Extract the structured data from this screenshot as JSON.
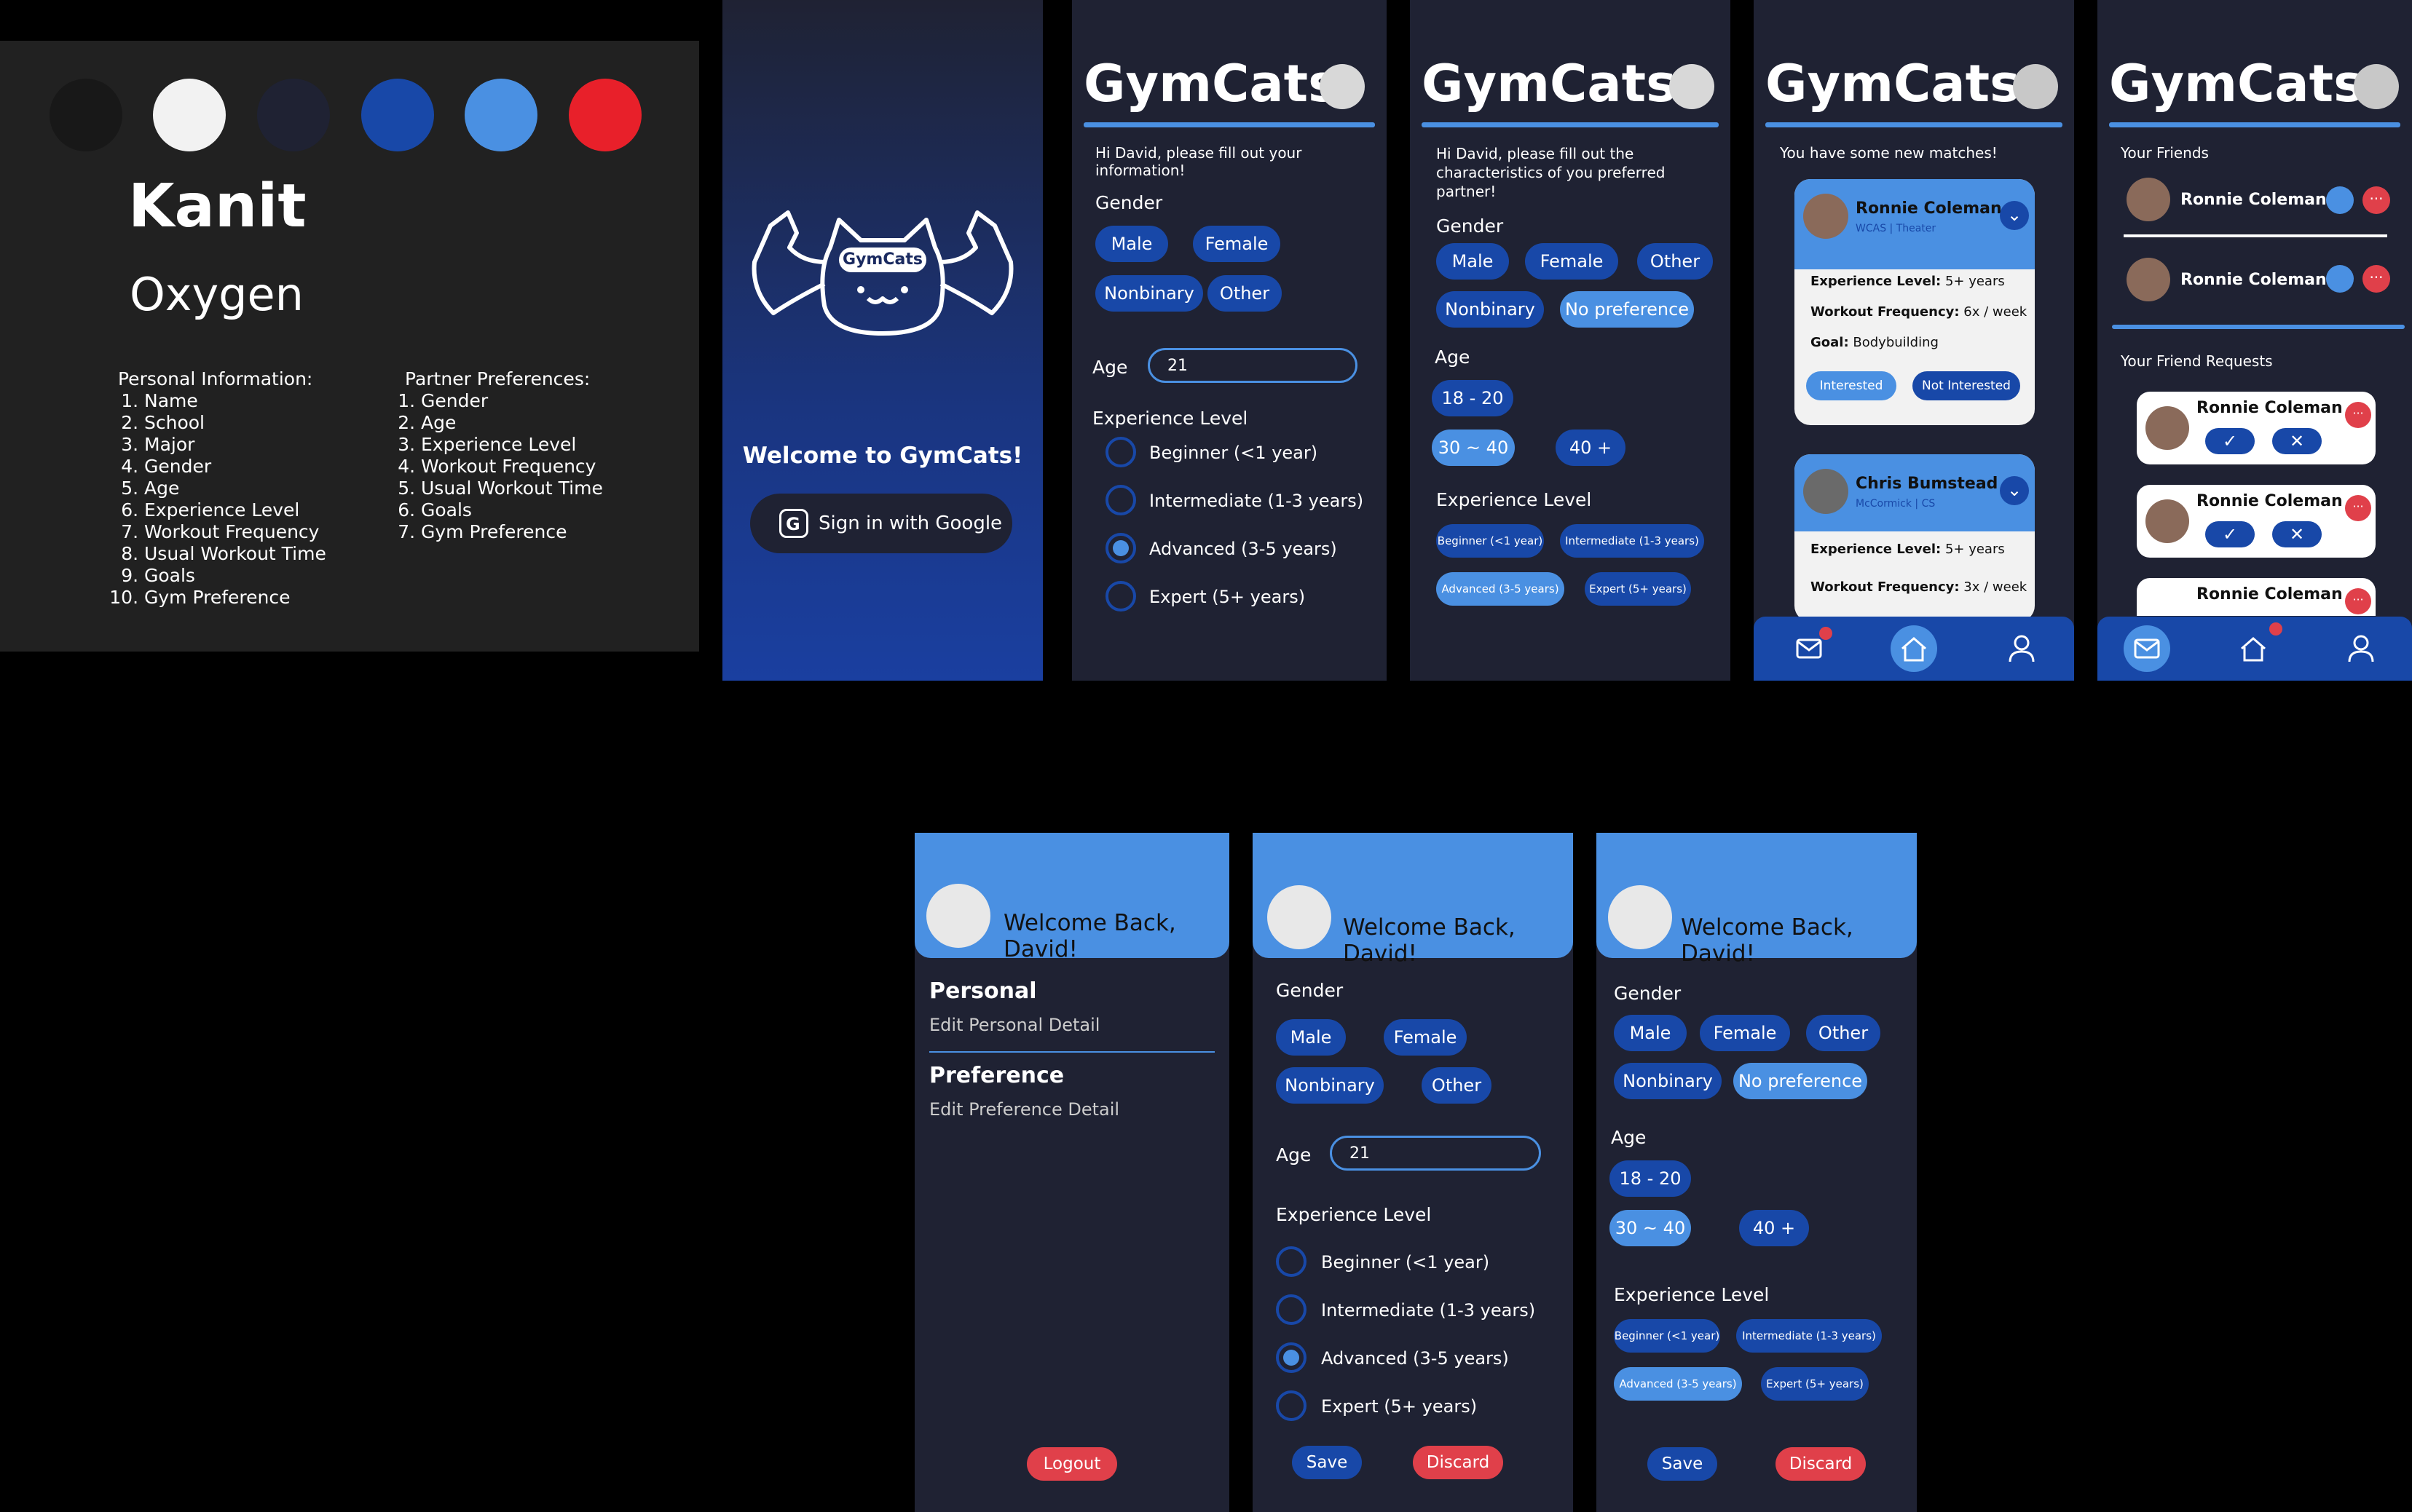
{
  "style_guide": {
    "colors": [
      "#181818",
      "#f2f2f2",
      "#1f2233",
      "#1848a8",
      "#4a90e2",
      "#e8202a"
    ],
    "font_primary": "Kanit",
    "font_secondary": "Oxygen",
    "personal_title": "Personal Information:",
    "personal_items": [
      "Name",
      "School",
      "Major",
      "Gender",
      "Age",
      "Experience Level",
      "Workout Frequency",
      "Usual Workout Time",
      "Goals",
      "Gym Preference"
    ],
    "partner_title": "Partner Preferences:",
    "partner_items": [
      "Gender",
      "Age",
      "Experience Level",
      "Workout Frequency",
      "Usual Workout Time",
      "Goals",
      "Gym Preference"
    ]
  },
  "welcome": {
    "logo_text": "GymCats",
    "title": "Welcome to GymCats!",
    "google_button": "Sign in with Google"
  },
  "app_title": "GymCats",
  "info_screen": {
    "prompt": "Hi David, please fill out your information!",
    "gender_label": "Gender",
    "genders": [
      "Male",
      "Female",
      "Nonbinary",
      "Other"
    ],
    "age_label": "Age",
    "age_value": "21",
    "exp_label": "Experience Level",
    "levels": [
      "Beginner (<1 year)",
      "Intermediate (1-3 years)",
      "Advanced (3-5 years)",
      "Expert (5+ years)"
    ]
  },
  "pref_screen": {
    "prompt": "Hi David, please fill out the characteristics of you preferred partner!",
    "gender_label": "Gender",
    "genders": [
      "Male",
      "Female",
      "Other",
      "Nonbinary",
      "No preference"
    ],
    "age_label": "Age",
    "ages": [
      "18 - 20",
      "30 ~ 40",
      "40 +"
    ],
    "exp_label": "Experience Level",
    "levels": [
      "Beginner (<1 year)",
      "Intermediate (1-3 years)",
      "Advanced (3-5 years)",
      "Expert (5+ years)"
    ]
  },
  "matches_screen": {
    "notice": "You have some new matches!",
    "card1": {
      "name": "Ronnie Coleman",
      "sub": "WCAS | Theater",
      "exp_k": "Experience Level:",
      "exp_v": "5+ years",
      "freq_k": "Workout Frequency:",
      "freq_v": "6x / week",
      "goal_k": "Goal:",
      "goal_v": "Bodybuilding",
      "interested": "Interested",
      "not_interested": "Not Interested"
    },
    "card2": {
      "name": "Chris Bumstead",
      "sub": "McCormick | CS",
      "exp_k": "Experience Level:",
      "exp_v": "5+ years",
      "freq_k": "Workout Frequency:",
      "freq_v": "3x / week"
    }
  },
  "friends_screen": {
    "friends_label": "Your Friends",
    "friends": [
      "Ronnie Coleman",
      "Ronnie Coleman"
    ],
    "requests_label": "Your Friend Requests",
    "requests": [
      "Ronnie Coleman",
      "Ronnie Coleman",
      "Ronnie Coleman"
    ]
  },
  "profile": {
    "welcome": "Welcome Back, David!",
    "personal": "Personal",
    "personal_sub": "Edit Personal Detail",
    "preference": "Preference",
    "preference_sub": "Edit Preference Detail",
    "logout": "Logout"
  },
  "edit_personal": {
    "welcome": "Welcome Back, David!",
    "gender_label": "Gender",
    "genders": [
      "Male",
      "Female",
      "Nonbinary",
      "Other"
    ],
    "age_label": "Age",
    "age_value": "21",
    "exp_label": "Experience Level",
    "levels": [
      "Beginner (<1 year)",
      "Intermediate (1-3 years)",
      "Advanced (3-5 years)",
      "Expert (5+ years)"
    ],
    "save": "Save",
    "discard": "Discard"
  },
  "edit_pref": {
    "welcome": "Welcome Back, David!",
    "gender_label": "Gender",
    "genders": [
      "Male",
      "Female",
      "Other",
      "Nonbinary",
      "No preference"
    ],
    "age_label": "Age",
    "ages": [
      "18 - 20",
      "30 ~ 40",
      "40 +"
    ],
    "exp_label": "Experience Level",
    "levels": [
      "Beginner (<1 year)",
      "Intermediate (1-3 years)",
      "Advanced (3-5 years)",
      "Expert (5+ years)"
    ],
    "save": "Save",
    "discard": "Discard"
  }
}
